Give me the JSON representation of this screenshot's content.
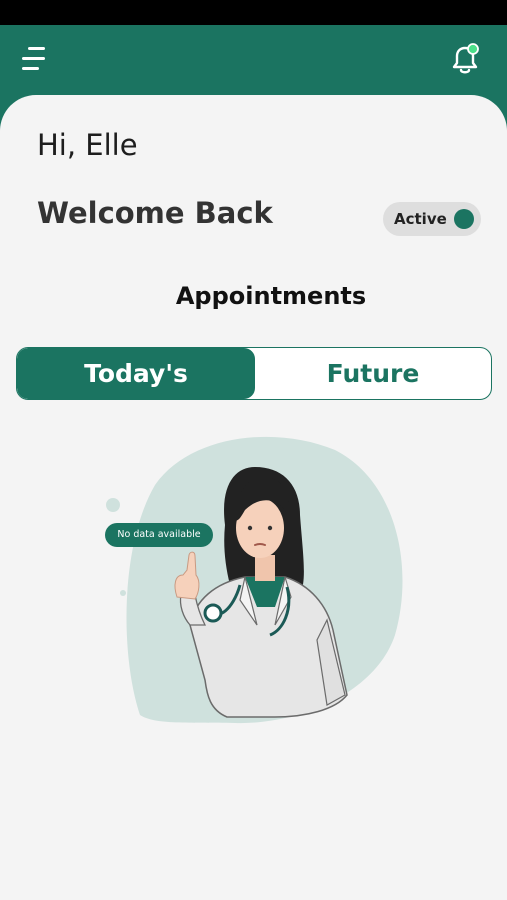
{
  "header": {
    "menu_icon": "menu-icon",
    "bell_icon": "bell-icon"
  },
  "greeting": "Hi, Elle",
  "welcome": "Welcome Back",
  "status_toggle": {
    "label": "Active",
    "on": true
  },
  "section_title": "Appointments",
  "tabs": [
    {
      "label": "Today's",
      "selected": true
    },
    {
      "label": "Future",
      "selected": false
    }
  ],
  "empty_state": {
    "message": "No data available"
  },
  "colors": {
    "primary": "#1b7461",
    "background": "#f4f4f4",
    "blob": "#cfe1dd"
  }
}
